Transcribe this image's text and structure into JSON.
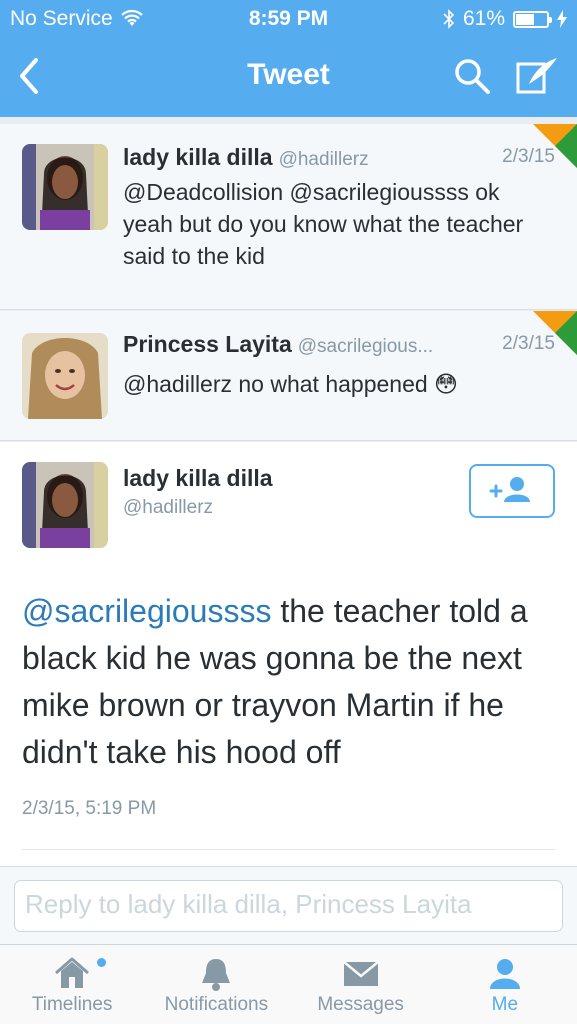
{
  "status_bar": {
    "carrier": "No Service",
    "time": "8:59 PM",
    "battery": "61%",
    "battery_level": 0.61
  },
  "nav": {
    "title": "Tweet",
    "back_icon": "chevron-left-icon",
    "search_icon": "search-icon",
    "compose_icon": "compose-icon"
  },
  "thread": [
    {
      "name": "lady killa dilla",
      "handle": "@hadillerz",
      "date": "2/3/15",
      "text": "@Deadcollision @sacrilegioussss ok yeah but do you know what the teacher said to the kid"
    },
    {
      "name": "Princess Layita",
      "handle": "@sacrilegious...",
      "date": "2/3/15",
      "text": "@hadillerz no what happened 😳"
    }
  ],
  "main_tweet": {
    "name": "lady killa dilla",
    "handle": "@hadillerz",
    "mention": "@sacrilegioussss",
    "text": " the teacher told a black kid he was gonna be the next mike brown or trayvon Martin if he didn't take his hood off",
    "timestamp": "2/3/15, 5:19 PM",
    "follow_icon": "add-user-icon"
  },
  "reply": {
    "placeholder": "Reply to lady killa dilla, Princess Layita"
  },
  "tabs": [
    {
      "label": "Timelines",
      "icon": "home-icon"
    },
    {
      "label": "Notifications",
      "icon": "bell-icon"
    },
    {
      "label": "Messages",
      "icon": "envelope-icon"
    },
    {
      "label": "Me",
      "icon": "person-icon"
    }
  ],
  "colors": {
    "brand": "#55acee",
    "link": "#2b7bb9",
    "muted": "#8899a6"
  }
}
